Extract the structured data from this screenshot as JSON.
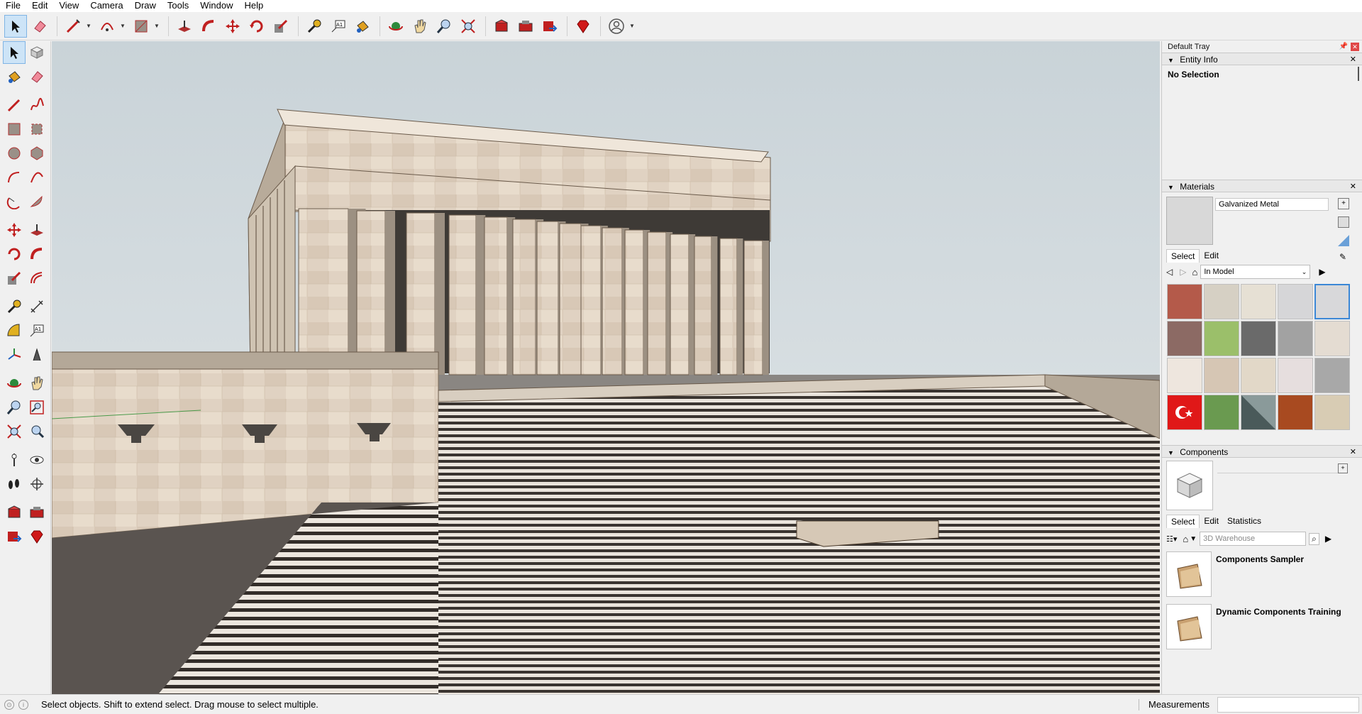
{
  "menu": [
    "File",
    "Edit",
    "View",
    "Camera",
    "Draw",
    "Tools",
    "Window",
    "Help"
  ],
  "toolbar": {
    "icons": [
      "select-icon",
      "eraser-icon",
      "line-icon",
      "arc-icon",
      "rectangle-icon",
      "push-pull-icon",
      "follow-me-icon",
      "move-icon",
      "rotate-icon",
      "scale-icon",
      "tape-measure-icon",
      "text-icon",
      "paint-bucket-icon",
      "orbit-icon",
      "pan-icon",
      "zoom-icon",
      "zoom-extents-icon",
      "warehouse-icon",
      "extension-warehouse-icon",
      "share-model-icon",
      "ruby-icon",
      "account-icon"
    ]
  },
  "left_tools": [
    [
      "select-icon",
      "make-component-icon"
    ],
    [
      "paint-bucket-icon",
      "eraser-icon"
    ],
    [
      "line-icon",
      "freehand-icon"
    ],
    [
      "rectangle-icon",
      "rotated-rectangle-icon"
    ],
    [
      "circle-icon",
      "polygon-icon"
    ],
    [
      "arc-icon",
      "two-point-arc-icon"
    ],
    [
      "pie-icon",
      "three-point-arc-icon"
    ],
    [
      "move-icon",
      "push-pull-icon"
    ],
    [
      "rotate-icon",
      "follow-me-icon"
    ],
    [
      "scale-icon",
      "offset-icon"
    ],
    [
      "tape-measure-icon",
      "dimension-icon"
    ],
    [
      "protractor-icon",
      "text-icon"
    ],
    [
      "axes-icon",
      "3d-text-icon"
    ],
    [
      "orbit-icon",
      "pan-icon"
    ],
    [
      "zoom-icon",
      "zoom-window-icon"
    ],
    [
      "zoom-extents-icon",
      "previous-view-icon"
    ],
    [
      "position-camera-icon",
      "look-around-icon"
    ],
    [
      "walk-icon",
      "section-plane-icon"
    ],
    [
      "warehouse-icon",
      "extension-warehouse-icon"
    ],
    [
      "share-model-icon",
      "ruby-icon"
    ]
  ],
  "tray": {
    "title": "Default Tray",
    "entity_info": {
      "title": "Entity Info",
      "selection": "No Selection"
    },
    "materials": {
      "title": "Materials",
      "current_name": "Galvanized Metal",
      "tab_select": "Select",
      "tab_edit": "Edit",
      "collection": "In Model",
      "swatches": [
        "#b45a4a",
        "#d6d0c4",
        "#e6e0d4",
        "#d6d6d8",
        "#d8d8da",
        "#8c6a64",
        "#9bbf6a",
        "#6a6a6a",
        "#a2a2a2",
        "#e4dcd2",
        "#eee6de",
        "#d6c6b4",
        "#e2d8c8",
        "#e6dede",
        "#a8a8a8",
        "#e01818",
        "#6a9a50",
        "#8a9a9a",
        "#a84a20",
        "#d8ccb4"
      ]
    },
    "components": {
      "title": "Components",
      "tab_select": "Select",
      "tab_edit": "Edit",
      "tab_statistics": "Statistics",
      "search_placeholder": "3D Warehouse",
      "items": [
        "Components Sampler",
        "Dynamic Components Training"
      ]
    }
  },
  "status": {
    "message": "Select objects. Shift to extend select. Drag mouse to select multiple.",
    "measurements_label": "Measurements",
    "measurements_value": ""
  }
}
